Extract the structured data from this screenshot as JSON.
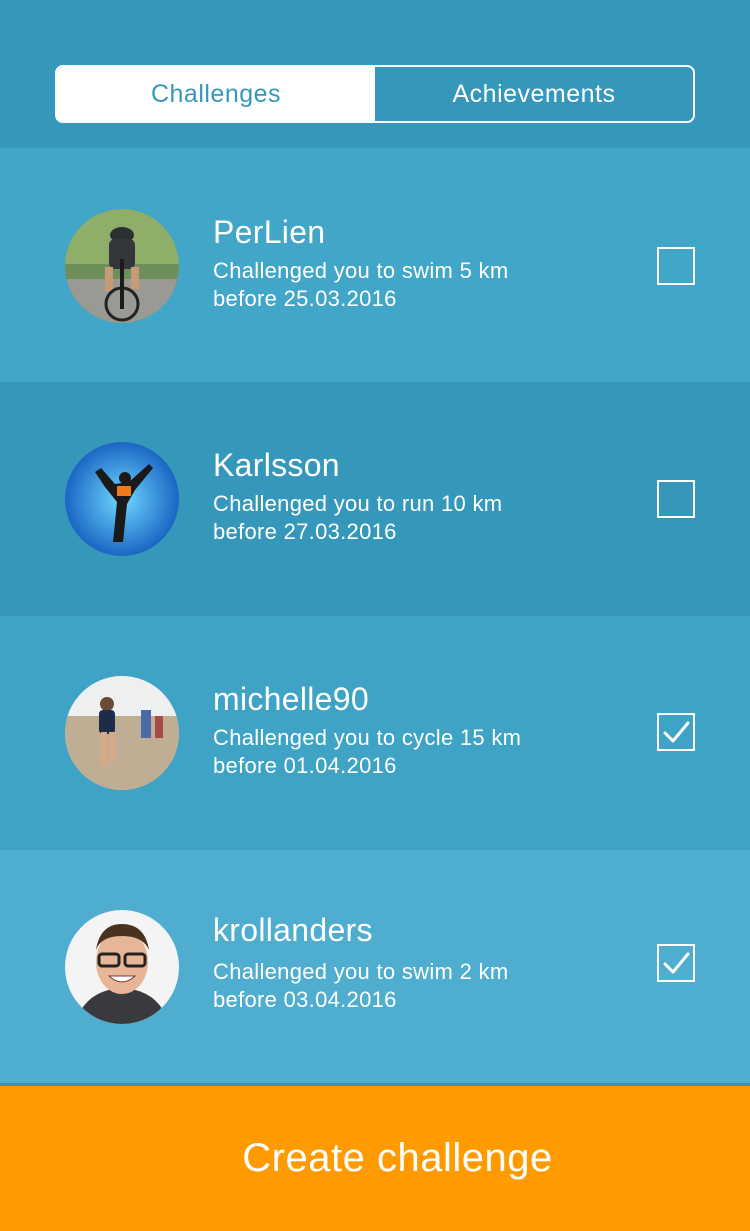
{
  "tabs": [
    {
      "label": "Challenges",
      "active": true
    },
    {
      "label": "Achievements",
      "active": false
    }
  ],
  "challenges": [
    {
      "name": "PerLien",
      "line1": "Challenged you to swim 5 km",
      "line2": "before 25.03.2016",
      "checked": false,
      "bg": "#41a6c7",
      "avatar": "cyclist-photo"
    },
    {
      "name": "Karlsson",
      "line1": "Challenged you to run 10 km",
      "line2": "before 27.03.2016",
      "checked": false,
      "bg": "#3598bb",
      "avatar": "yoga-silhouette-photo"
    },
    {
      "name": "michelle90",
      "line1": "Challenged you to cycle 15 km",
      "line2": "before 01.04.2016",
      "checked": true,
      "bg": "#3ea3c4",
      "avatar": "runner-photo"
    },
    {
      "name": "krollanders",
      "line1": "Challenged you to swim 2 km",
      "line2": "before 03.04.2016",
      "checked": true,
      "bg": "#4faed0",
      "avatar": "portrait-photo"
    }
  ],
  "cta": {
    "label": "Create challenge"
  },
  "colors": {
    "accent": "#ff9a00",
    "primary": "#3598bb"
  }
}
